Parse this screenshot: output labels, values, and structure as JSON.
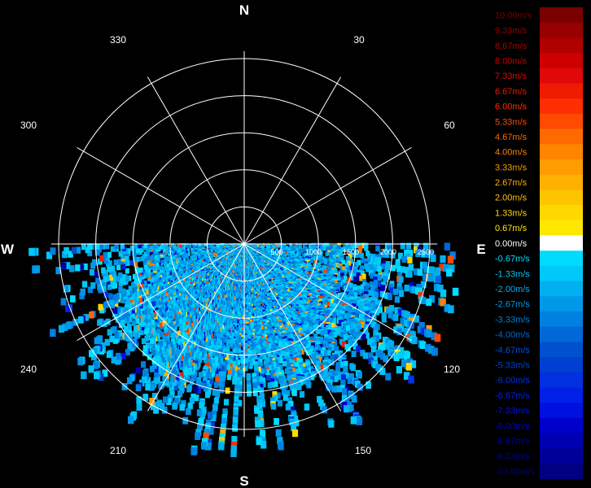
{
  "chart_data": {
    "type": "polar-heatmap",
    "title": "",
    "cardinal_labels": [
      "N",
      "E",
      "S",
      "W"
    ],
    "bearing_labels": [
      "30",
      "60",
      "120",
      "150",
      "210",
      "240",
      "300",
      "330"
    ],
    "range_labels": [
      "500",
      "1000",
      "1500",
      "2000",
      "2500"
    ],
    "range_max": 2600,
    "azimuth_sector_deg": [
      90,
      270
    ],
    "unit": "m/s",
    "value_range": [
      -10,
      10
    ],
    "grid": true,
    "legend_position": "right",
    "legend": [
      {
        "label": "10.00m/s",
        "color": "#7a0000"
      },
      {
        "label": "9.33m/s",
        "color": "#960000"
      },
      {
        "label": "8.67m/s",
        "color": "#b00000"
      },
      {
        "label": "8.00m/s",
        "color": "#cc0000"
      },
      {
        "label": "7.33m/s",
        "color": "#e00808"
      },
      {
        "label": "6.67m/s",
        "color": "#f01a00"
      },
      {
        "label": "6.00m/s",
        "color": "#ff2e00"
      },
      {
        "label": "5.33m/s",
        "color": "#ff4a00"
      },
      {
        "label": "4.67m/s",
        "color": "#ff6a00"
      },
      {
        "label": "4.00m/s",
        "color": "#ff8400"
      },
      {
        "label": "3.33m/s",
        "color": "#ff9c00"
      },
      {
        "label": "2.67m/s",
        "color": "#ffb000"
      },
      {
        "label": "2.00m/s",
        "color": "#ffc400"
      },
      {
        "label": "1.33m/s",
        "color": "#ffd800"
      },
      {
        "label": "0.67m/s",
        "color": "#ffe800"
      },
      {
        "label": "0.00m/s",
        "color": "#ffffff"
      },
      {
        "label": "-0.67m/s",
        "color": "#00dcff"
      },
      {
        "label": "-1.33m/s",
        "color": "#00c8f8"
      },
      {
        "label": "-2.00m/s",
        "color": "#00b0f0"
      },
      {
        "label": "-2.67m/s",
        "color": "#0098e8"
      },
      {
        "label": "-3.33m/s",
        "color": "#0080e0"
      },
      {
        "label": "-4.00m/s",
        "color": "#0068d8"
      },
      {
        "label": "-4.67m/s",
        "color": "#0050d0"
      },
      {
        "label": "-5.33m/s",
        "color": "#0040d0"
      },
      {
        "label": "-6.00m/s",
        "color": "#0030e0"
      },
      {
        "label": "-6.67m/s",
        "color": "#0020e8"
      },
      {
        "label": "-7.33m/s",
        "color": "#0010e0"
      },
      {
        "label": "-8.00m/s",
        "color": "#0000cc"
      },
      {
        "label": "-8.67m/s",
        "color": "#0000b0"
      },
      {
        "label": "-9.33m/s",
        "color": "#000098"
      },
      {
        "label": "-10.00m/s",
        "color": "#000080"
      }
    ]
  }
}
